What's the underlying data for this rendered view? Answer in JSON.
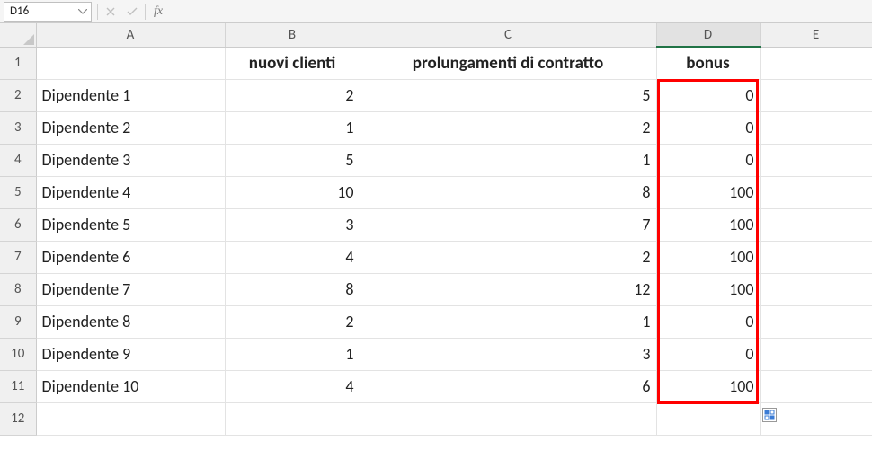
{
  "namebox": {
    "value": "D16"
  },
  "formula_bar": {
    "value": ""
  },
  "fx_label": "fx",
  "col_letters": [
    "A",
    "B",
    "C",
    "D",
    "E"
  ],
  "row_numbers": [
    "1",
    "2",
    "3",
    "4",
    "5",
    "6",
    "7",
    "8",
    "9",
    "10",
    "11",
    "12"
  ],
  "headers": {
    "A": "",
    "B": "nuovi clienti",
    "C": "prolungamenti di contratto",
    "D": "bonus"
  },
  "rows": [
    {
      "label": "Dipendente 1",
      "B": "2",
      "C": "5",
      "D": "0"
    },
    {
      "label": "Dipendente 2",
      "B": "1",
      "C": "2",
      "D": "0"
    },
    {
      "label": "Dipendente 3",
      "B": "5",
      "C": "1",
      "D": "0"
    },
    {
      "label": "Dipendente 4",
      "B": "10",
      "C": "8",
      "D": "100"
    },
    {
      "label": "Dipendente 5",
      "B": "3",
      "C": "7",
      "D": "100"
    },
    {
      "label": "Dipendente 6",
      "B": "4",
      "C": "2",
      "D": "100"
    },
    {
      "label": "Dipendente 7",
      "B": "8",
      "C": "12",
      "D": "100"
    },
    {
      "label": "Dipendente 8",
      "B": "2",
      "C": "1",
      "D": "0"
    },
    {
      "label": "Dipendente 9",
      "B": "1",
      "C": "3",
      "D": "0"
    },
    {
      "label": "Dipendente 10",
      "B": "4",
      "C": "6",
      "D": "100"
    }
  ]
}
